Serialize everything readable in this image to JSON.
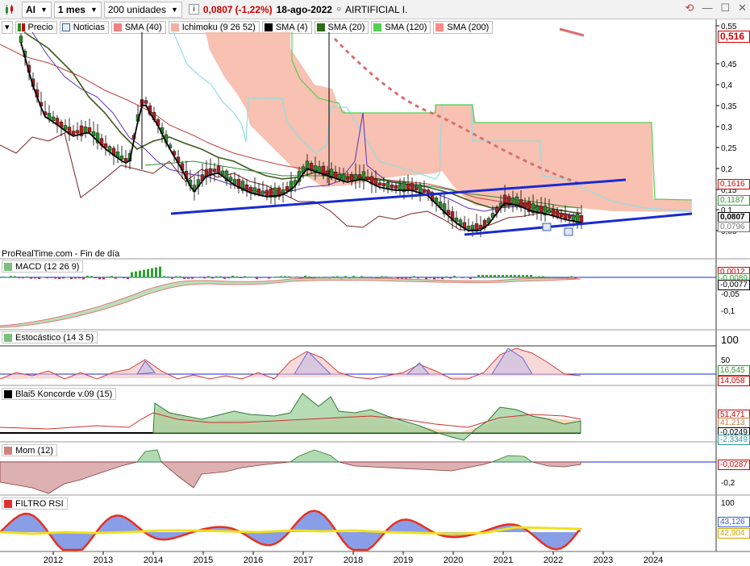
{
  "toolbar": {
    "symbol": "AI",
    "period": "1 mes",
    "units": "200 unidades",
    "last": "0,0807",
    "change": "(-1,22%)",
    "date": "18-ago-2022",
    "name": "AIRTIFICIAL I."
  },
  "indicators": [
    {
      "label": "Precio",
      "color": "#ffffff",
      "icon": "price-icon"
    },
    {
      "label": "Noticias",
      "color": "#ffffff",
      "icon": "news-icon"
    },
    {
      "label": "SMA (40)",
      "color": "#f08080"
    },
    {
      "label": "Ichimoku (9 26 52)",
      "color": "#f4b0a0"
    },
    {
      "label": "SMA (4)",
      "color": "#000000"
    },
    {
      "label": "SMA (20)",
      "color": "#2e6b1a"
    },
    {
      "label": "SMA (120)",
      "color": "#55d055"
    },
    {
      "label": "SMA (200)",
      "color": "#ff8a8a"
    }
  ],
  "price_axis": {
    "ticks": [
      "0,55",
      "0,45",
      "0,4",
      "0,35",
      "0,3",
      "0,25",
      "0,2",
      "0,15",
      "0,1",
      "0,05"
    ],
    "tags": [
      {
        "text": "0,516",
        "color": "#d00000"
      },
      {
        "text": "0,1616",
        "color": "#d00000"
      },
      {
        "text": "0,1187",
        "color": "#2f9a2f"
      },
      {
        "text": "0,0807",
        "color": "#000000"
      },
      {
        "text": "0,0796",
        "color": "#777777"
      }
    ]
  },
  "source_label": "ProRealTime.com - Fin de día",
  "macd": {
    "label": "MACD (12 26 9)",
    "ticks": [
      "-0,05",
      "-0,1"
    ],
    "tags": [
      {
        "text": "0,0012",
        "color": "#d00000"
      },
      {
        "text": "-0,0089",
        "color": "#2f9a2f"
      },
      {
        "text": "-0,0077",
        "color": "#000000"
      }
    ]
  },
  "stoch": {
    "label": "Estocástico (14 3 5)",
    "ticks": [
      "100",
      "50"
    ],
    "tags": [
      {
        "text": "16,545",
        "color": "#2f9a2f"
      },
      {
        "text": "14,058",
        "color": "#d00000"
      }
    ]
  },
  "koncorde": {
    "label": "Blai5 Koncorde v.09 (15)",
    "tags": [
      {
        "text": "51,471",
        "color": "#d00000"
      },
      {
        "text": "41,213",
        "color": "#c87a3a"
      },
      {
        "text": "-0,0249",
        "color": "#000000"
      },
      {
        "text": "-2,3349",
        "color": "#2f9a9a"
      }
    ]
  },
  "mom": {
    "label": "Mom (12)",
    "ticks": [
      "-0,2"
    ],
    "tags": [
      {
        "text": "-0,0287",
        "color": "#d00000"
      }
    ]
  },
  "rsi": {
    "label": "FILTRO RSI",
    "ticks": [
      "100"
    ],
    "tags": [
      {
        "text": "43,126",
        "color": "#2f5fd0"
      },
      {
        "text": "42,904",
        "color": "#d0a000"
      }
    ]
  },
  "x_axis": [
    "2012",
    "2013",
    "2014",
    "2015",
    "2016",
    "2017",
    "2018",
    "2019",
    "2020",
    "2021",
    "2022",
    "2023",
    "2024"
  ],
  "chart_data": {
    "type": "candlestick",
    "period": "1 mes",
    "price_ylim": [
      0.03,
      0.55
    ],
    "last_price": 0.0807,
    "x_years": [
      "2012",
      "2013",
      "2014",
      "2015",
      "2016",
      "2017",
      "2018",
      "2019",
      "2020",
      "2021",
      "2022",
      "2023",
      "2024"
    ]
  }
}
